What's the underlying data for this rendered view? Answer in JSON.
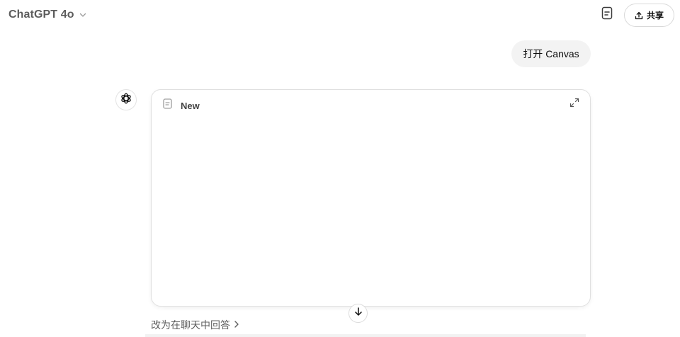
{
  "header": {
    "model_name": "ChatGPT 4o",
    "share_label": "共享"
  },
  "icons": {
    "model_dropdown": "chevron-down-icon",
    "document": "document-icon",
    "share": "share-upload-icon",
    "assistant_avatar": "openai-logo-icon",
    "canvas_doc": "document-icon",
    "expand": "expand-icon",
    "scroll_down": "arrow-down-icon",
    "reply_chevron": "chevron-right-icon"
  },
  "conversation": {
    "user_message": "打开 Canvas",
    "canvas": {
      "title": "New"
    },
    "reply_in_chat_label": "改为在聊天中回答"
  },
  "colors": {
    "bubble_bg": "#f3f3f3",
    "border": "#e0e0e0",
    "muted_text": "#5d5d5d"
  }
}
